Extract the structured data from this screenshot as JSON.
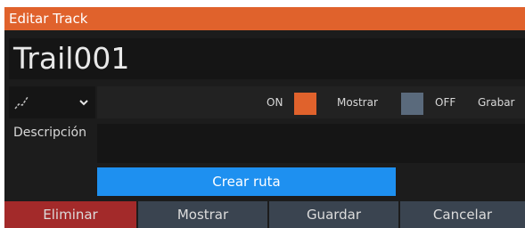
{
  "dialog": {
    "title": "Editar Track",
    "track_name": "Trail001",
    "line_style": "line-style-icon",
    "toggles": {
      "show": {
        "state": "ON",
        "label": "Mostrar",
        "swatch_color": "#e0622c"
      },
      "record": {
        "state": "OFF",
        "label": "Grabar",
        "swatch_color": "#5a6a7c"
      }
    },
    "description": {
      "label": "Descripción",
      "value": ""
    },
    "create_route_label": "Crear ruta",
    "buttons": {
      "delete": "Eliminar",
      "show": "Mostrar",
      "save": "Guardar",
      "cancel": "Cancelar"
    }
  },
  "colors": {
    "title_bar": "#e0622c",
    "delete_button": "#a32a2a",
    "primary_button": "#1e90f0",
    "footer_button": "#3a4450"
  }
}
